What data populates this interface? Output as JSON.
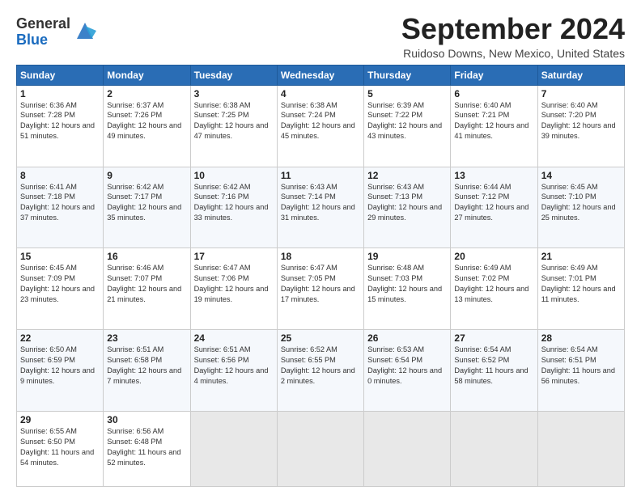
{
  "header": {
    "logo_line1": "General",
    "logo_line2": "Blue",
    "month": "September 2024",
    "location": "Ruidoso Downs, New Mexico, United States"
  },
  "days_header": [
    "Sunday",
    "Monday",
    "Tuesday",
    "Wednesday",
    "Thursday",
    "Friday",
    "Saturday"
  ],
  "weeks": [
    [
      {
        "day": "1",
        "sunrise": "6:36 AM",
        "sunset": "7:28 PM",
        "daylight": "12 hours and 51 minutes."
      },
      {
        "day": "2",
        "sunrise": "6:37 AM",
        "sunset": "7:26 PM",
        "daylight": "12 hours and 49 minutes."
      },
      {
        "day": "3",
        "sunrise": "6:38 AM",
        "sunset": "7:25 PM",
        "daylight": "12 hours and 47 minutes."
      },
      {
        "day": "4",
        "sunrise": "6:38 AM",
        "sunset": "7:24 PM",
        "daylight": "12 hours and 45 minutes."
      },
      {
        "day": "5",
        "sunrise": "6:39 AM",
        "sunset": "7:22 PM",
        "daylight": "12 hours and 43 minutes."
      },
      {
        "day": "6",
        "sunrise": "6:40 AM",
        "sunset": "7:21 PM",
        "daylight": "12 hours and 41 minutes."
      },
      {
        "day": "7",
        "sunrise": "6:40 AM",
        "sunset": "7:20 PM",
        "daylight": "12 hours and 39 minutes."
      }
    ],
    [
      {
        "day": "8",
        "sunrise": "6:41 AM",
        "sunset": "7:18 PM",
        "daylight": "12 hours and 37 minutes."
      },
      {
        "day": "9",
        "sunrise": "6:42 AM",
        "sunset": "7:17 PM",
        "daylight": "12 hours and 35 minutes."
      },
      {
        "day": "10",
        "sunrise": "6:42 AM",
        "sunset": "7:16 PM",
        "daylight": "12 hours and 33 minutes."
      },
      {
        "day": "11",
        "sunrise": "6:43 AM",
        "sunset": "7:14 PM",
        "daylight": "12 hours and 31 minutes."
      },
      {
        "day": "12",
        "sunrise": "6:43 AM",
        "sunset": "7:13 PM",
        "daylight": "12 hours and 29 minutes."
      },
      {
        "day": "13",
        "sunrise": "6:44 AM",
        "sunset": "7:12 PM",
        "daylight": "12 hours and 27 minutes."
      },
      {
        "day": "14",
        "sunrise": "6:45 AM",
        "sunset": "7:10 PM",
        "daylight": "12 hours and 25 minutes."
      }
    ],
    [
      {
        "day": "15",
        "sunrise": "6:45 AM",
        "sunset": "7:09 PM",
        "daylight": "12 hours and 23 minutes."
      },
      {
        "day": "16",
        "sunrise": "6:46 AM",
        "sunset": "7:07 PM",
        "daylight": "12 hours and 21 minutes."
      },
      {
        "day": "17",
        "sunrise": "6:47 AM",
        "sunset": "7:06 PM",
        "daylight": "12 hours and 19 minutes."
      },
      {
        "day": "18",
        "sunrise": "6:47 AM",
        "sunset": "7:05 PM",
        "daylight": "12 hours and 17 minutes."
      },
      {
        "day": "19",
        "sunrise": "6:48 AM",
        "sunset": "7:03 PM",
        "daylight": "12 hours and 15 minutes."
      },
      {
        "day": "20",
        "sunrise": "6:49 AM",
        "sunset": "7:02 PM",
        "daylight": "12 hours and 13 minutes."
      },
      {
        "day": "21",
        "sunrise": "6:49 AM",
        "sunset": "7:01 PM",
        "daylight": "12 hours and 11 minutes."
      }
    ],
    [
      {
        "day": "22",
        "sunrise": "6:50 AM",
        "sunset": "6:59 PM",
        "daylight": "12 hours and 9 minutes."
      },
      {
        "day": "23",
        "sunrise": "6:51 AM",
        "sunset": "6:58 PM",
        "daylight": "12 hours and 7 minutes."
      },
      {
        "day": "24",
        "sunrise": "6:51 AM",
        "sunset": "6:56 PM",
        "daylight": "12 hours and 4 minutes."
      },
      {
        "day": "25",
        "sunrise": "6:52 AM",
        "sunset": "6:55 PM",
        "daylight": "12 hours and 2 minutes."
      },
      {
        "day": "26",
        "sunrise": "6:53 AM",
        "sunset": "6:54 PM",
        "daylight": "12 hours and 0 minutes."
      },
      {
        "day": "27",
        "sunrise": "6:54 AM",
        "sunset": "6:52 PM",
        "daylight": "11 hours and 58 minutes."
      },
      {
        "day": "28",
        "sunrise": "6:54 AM",
        "sunset": "6:51 PM",
        "daylight": "11 hours and 56 minutes."
      }
    ],
    [
      {
        "day": "29",
        "sunrise": "6:55 AM",
        "sunset": "6:50 PM",
        "daylight": "11 hours and 54 minutes."
      },
      {
        "day": "30",
        "sunrise": "6:56 AM",
        "sunset": "6:48 PM",
        "daylight": "11 hours and 52 minutes."
      },
      null,
      null,
      null,
      null,
      null
    ]
  ]
}
